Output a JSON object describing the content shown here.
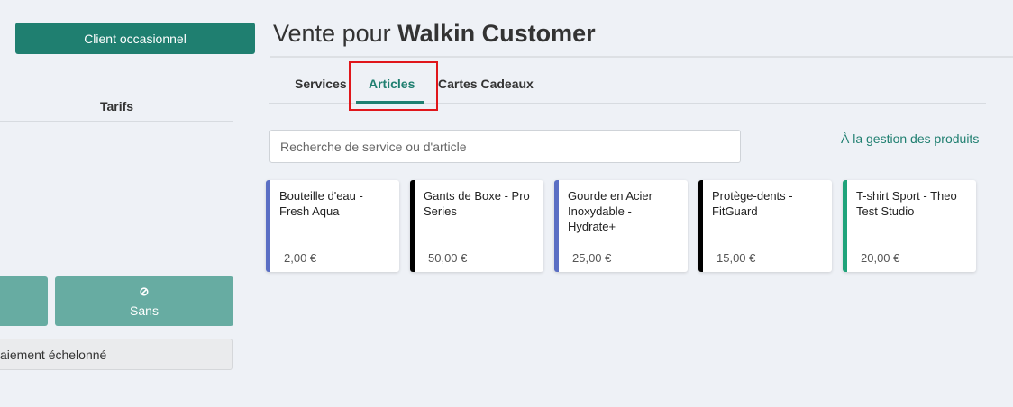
{
  "left": {
    "client_button": "Client occasionnel",
    "tarifs_label": "Tarifs",
    "sans_icon": "⊘",
    "sans_button": "Sans",
    "paiement_label": "aiement échelonné"
  },
  "header": {
    "title_prefix": "Vente pour",
    "title_customer": "Walkin Customer"
  },
  "tabs": [
    {
      "label": "Services",
      "active": false
    },
    {
      "label": "Articles",
      "active": true
    },
    {
      "label": "Cartes Cadeaux",
      "active": false
    }
  ],
  "search": {
    "placeholder": "Recherche de service ou d'article",
    "value": ""
  },
  "gestion_link": "À la gestion des produits",
  "products": [
    {
      "name": "Bouteille d'eau - Fresh Aqua",
      "price": "2,00 €",
      "color": "#5b6fc4"
    },
    {
      "name": "Gants de Boxe - Pro Series",
      "price": "50,00 €",
      "color": "#000000"
    },
    {
      "name": "Gourde en Acier Inoxydable - Hydrate+",
      "price": "25,00 €",
      "color": "#5b6fc4"
    },
    {
      "name": "Protège-dents - FitGuard",
      "price": "15,00 €",
      "color": "#000000"
    },
    {
      "name": "T-shirt Sport - Theo Test Studio",
      "price": "20,00 €",
      "color": "#1fa37a"
    }
  ],
  "colors": {
    "accent": "#1f7f70",
    "accent_light": "#67aca2",
    "highlight": "#e0161b"
  }
}
